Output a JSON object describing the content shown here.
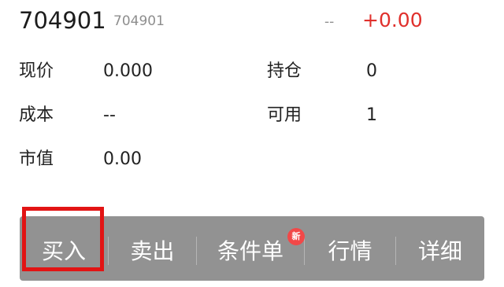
{
  "header": {
    "code": "704901",
    "subcode": "704901",
    "price_dash": "--",
    "change": "+0.00"
  },
  "fields": {
    "current_price": {
      "label": "现价",
      "value": "0.000"
    },
    "holding": {
      "label": "持仓",
      "value": "0"
    },
    "cost": {
      "label": "成本",
      "value": "--"
    },
    "available": {
      "label": "可用",
      "value": "1"
    },
    "market_value": {
      "label": "市值",
      "value": "0.00"
    }
  },
  "toolbar": {
    "buy": "买入",
    "sell": "卖出",
    "conditional_order": "条件单",
    "new_badge": "新",
    "quotes": "行情",
    "details": "详细"
  },
  "colors": {
    "up_red": "#e0302c",
    "badge_red": "#f24848",
    "highlight_red": "#e21414",
    "toolbar_bg": "#929292"
  }
}
